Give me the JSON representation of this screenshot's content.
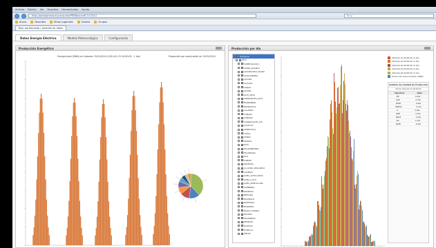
{
  "browser": {
    "menu": [
      "Archivo",
      "Edición",
      "Ver",
      "Favoritos",
      "Herramientas",
      "Ayuda"
    ],
    "address": "http://portalpresto.es/consumo/PRTBalanceR-1V-2014",
    "search_placeholder": "Bing",
    "favorites": [
      "Ahora",
      "Favoritos",
      "Sitios sugeridos",
      "Galería",
      "Grupos"
    ],
    "page_tab": "Reg: portalpresto | pantalla de datos"
  },
  "app": {
    "tabs": [
      "Datos Energía Eléctrica",
      "Modelo Meteorológico",
      "Configuración"
    ],
    "active_tab": 0
  },
  "left_panel": {
    "title": "Producción Energética",
    "chart_title": "Energía total (MWh) en Subasta: 31/01/2014 (2014-01-31 00:00:00 - 1 día)",
    "pie_title": "Proporción por valor/ración en 31/01/2014"
  },
  "right_panel": {
    "title": "Producción por día",
    "tree": [
      {
        "label": "Enclosure",
        "level": 0,
        "selected": true
      },
      {
        "label": "PETS",
        "level": 1
      },
      {
        "label": "SUBESTACION_1",
        "level": 2
      },
      {
        "label": "ACERO_BLANCO",
        "level": 2
      },
      {
        "label": "AGUABLANCA_BLANC",
        "level": 2
      },
      {
        "label": "AGUILANDERA",
        "level": 2
      },
      {
        "label": "ALCORA",
        "level": 2
      },
      {
        "label": "ALCUDIA",
        "level": 2
      },
      {
        "label": "ALEJAR",
        "level": 2
      },
      {
        "label": "ALTURA",
        "level": 2
      },
      {
        "label": "ALTO_SECO",
        "level": 2
      },
      {
        "label": "ARENAZALES_JOCO",
        "level": 2
      },
      {
        "label": "BURBANERA",
        "level": 2
      },
      {
        "label": "BUENAVISTA",
        "level": 2
      },
      {
        "label": "CALANDA",
        "level": 2
      },
      {
        "label": "CAÑADA",
        "level": 2
      },
      {
        "label": "CAÑIZAR",
        "level": 2
      },
      {
        "label": "CARRASCALES_STA",
        "level": 2
      },
      {
        "label": "CASTILLO",
        "level": 2
      },
      {
        "label": "CERRATILLO",
        "level": 2
      },
      {
        "label": "CUEVA",
        "level": 2
      },
      {
        "label": "CERRO",
        "level": 2
      },
      {
        "label": "DEHESA",
        "level": 2
      },
      {
        "label": "ELSA",
        "level": 2
      },
      {
        "label": "ESCAMBRONES",
        "level": 2
      },
      {
        "label": "ESCARPADA",
        "level": 2
      },
      {
        "label": "FILO",
        "level": 2
      },
      {
        "label": "FUENTE",
        "level": 2
      },
      {
        "label": "GRANADA",
        "level": 2
      },
      {
        "label": "LA_LOMA_ARGUARDA",
        "level": 2
      },
      {
        "label": "LADERAS",
        "level": 2
      },
      {
        "label": "LOMA_ALTOLLANOS",
        "level": 2
      },
      {
        "label": "LOMA_LLAUT",
        "level": 2
      },
      {
        "label": "LOMA_MONTILLANA",
        "level": 2
      },
      {
        "label": "LUMBRERA",
        "level": 2
      },
      {
        "label": "MADERAS",
        "level": 2
      },
      {
        "label": "MEDIANA",
        "level": 2
      },
      {
        "label": "MOLINILLO",
        "level": 2
      },
      {
        "label": "MONTARAL",
        "level": 2
      },
      {
        "label": "MONTERO",
        "level": 2
      },
      {
        "label": "NAVAS_ZORRAS",
        "level": 2
      },
      {
        "label": "PALOMO",
        "level": 2
      },
      {
        "label": "PALOMERAS",
        "level": 2
      },
      {
        "label": "PEDRAZA",
        "level": 2
      },
      {
        "label": "PLANTAS",
        "level": 2
      },
      {
        "label": "PUNTILLA",
        "level": 2
      },
      {
        "label": "RIELES",
        "level": 2
      }
    ],
    "legend": [
      {
        "label": "2014-01-31 00:00:00 (1 día)",
        "color": "#c0504d"
      },
      {
        "label": "2014-02-01 00:00:00 (1 día)",
        "color": "#e36c09"
      },
      {
        "label": "2014-02-02 00:00:00 (1 día)",
        "color": "#8a5a44"
      },
      {
        "label": "2014-02-03 00:00:00 (1 día)",
        "color": "#d99a3a"
      },
      {
        "label": "2014-02-04 00:00:00 (1 día)",
        "color": "#9bbb59"
      },
      {
        "label": "Producción total medición (MWh)",
        "color": "#4f81bd"
      }
    ],
    "stats": {
      "title": "Análisis de Calidad de Predicción",
      "subtitle": "Fecha: 2014-01-31 00:00:00",
      "headers": [
        "Tipo Error",
        "Valor"
      ],
      "rows": [
        [
          "ME",
          "0.045"
        ],
        [
          "MAE",
          "0.756"
        ],
        [
          "RMSE",
          "0.802"
        ],
        [
          "NRMSE",
          "0.124"
        ],
        [
          "R",
          "0.962"
        ],
        [
          "NME",
          "0.031"
        ],
        [
          "NMAE",
          "0.245"
        ],
        [
          "MA",
          "0.125"
        ],
        [
          "MAPE",
          "0.401"
        ]
      ]
    }
  },
  "colors": {
    "orange": "#d9793a",
    "blue": "#4f81bd",
    "red": "#c0504d",
    "green": "#9bbb59"
  }
}
